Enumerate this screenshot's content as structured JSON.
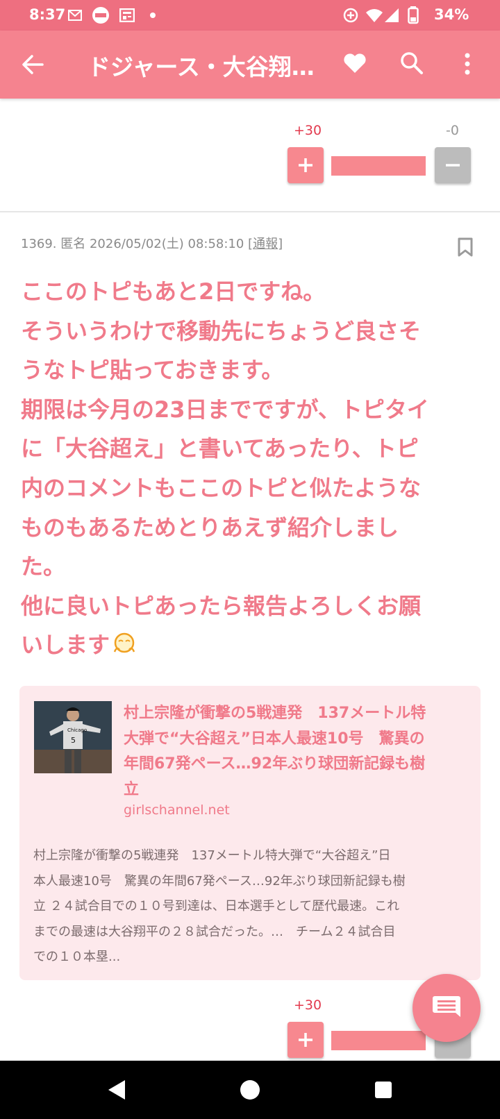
{
  "status_bar": {
    "time": "8:37",
    "battery": "34%",
    "icons": [
      "mail-icon",
      "app-badge-icon",
      "news-icon",
      "dot-icon",
      "data-saver-icon",
      "wifi-icon",
      "signal-icon",
      "battery-icon"
    ]
  },
  "app_bar": {
    "title": "ドジャース・大谷翔…",
    "icons": [
      "back-arrow-icon",
      "heart-icon",
      "search-icon",
      "more-vert-icon"
    ]
  },
  "top_vote": {
    "plus_count": "+30",
    "minus_count": "-0",
    "plus_label": "+",
    "minus_label": "−"
  },
  "comment": {
    "meta": "1369. 匿名 2026/05/02(土) 08:58:10 [",
    "report": "通報",
    "meta_close": "]",
    "lines": [
      "ここのトピもあと2日ですね。",
      "そういうわけで移動先にちょうど良さそ",
      "うなトピ貼っておきます。",
      "期限は今月の23日までですが、トピタイ",
      "に「大谷超え」と書いてあったり、トピ",
      "内のコメントもここのトピと似たような",
      "ものもあるためとりあえず紹介しまし",
      "た。",
      "他に良いトピあったら報告よろしくお願",
      "いします"
    ]
  },
  "link_card": {
    "title_lines": [
      "村上宗隆が衝撃の5戦連発　137メートル特",
      "大弾で“大谷超え”日本人最速10号　驚異の",
      "年間67発ペース…92年ぶり球団新記録も樹",
      "立"
    ],
    "domain": "girlschannel.net",
    "desc_lines": [
      "村上宗隆が衝撃の5戦連発　137メートル特大弾で“大谷超え”日",
      "本人最速10号　驚異の年間67発ペース…92年ぶり球団新記録も樹",
      "立 ２４試合目での１０号到達は、日本選手として歴代最速。これ",
      "までの最速は大谷翔平の２８試合だった。…　チーム２４試合目",
      "での１０本塁..."
    ]
  },
  "bottom_vote": {
    "plus_count": "+30",
    "plus_label": "+"
  },
  "colors": {
    "accent": "#f5838f",
    "status_bar": "#ee6f80",
    "text_pink": "#f07a8a",
    "card_bg": "#fde9ec"
  }
}
